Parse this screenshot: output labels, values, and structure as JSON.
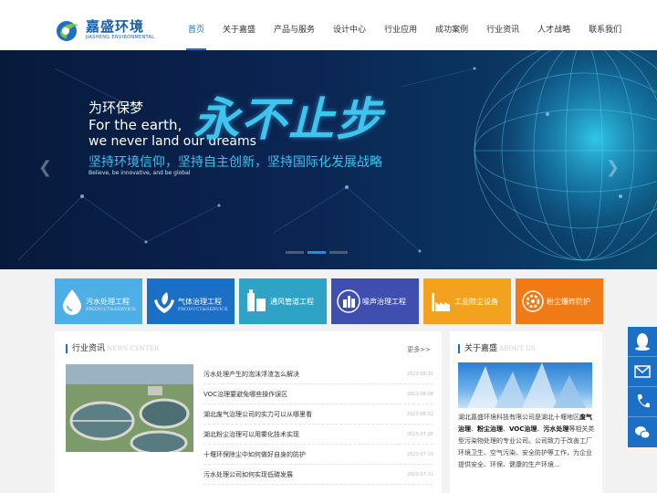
{
  "brand": {
    "name_cn": "嘉盛环境",
    "name_en": "JIASHENG ENVIRONMENTAL",
    "colors": {
      "primary": "#1b6fc4",
      "accent": "#33c6f0"
    }
  },
  "nav": {
    "items": [
      "首页",
      "关于嘉盛",
      "产品与服务",
      "设计中心",
      "行业应用",
      "成功案例",
      "行业资讯",
      "人才战略",
      "联系我们"
    ],
    "active_index": 0
  },
  "banner": {
    "line1": "为环保梦",
    "line2": "For the earth,",
    "line3": "we never land our dreams",
    "big": "永不止步",
    "slogan": "坚持环境信仰，坚持自主创新，坚持国际化发展战略",
    "sub": "Believe, be innovative, and be global",
    "prev_icon": "chevron-left-icon",
    "next_icon": "chevron-right-icon",
    "slide_count": 3,
    "active_slide": 1
  },
  "services": [
    {
      "title": "污水处理工程",
      "sub": "PRODUCT&SERVICE",
      "color": "#4eaee6",
      "icon": "water-drop-icon"
    },
    {
      "title": "气体治理工程",
      "sub": "PRODUCT&SERVICE",
      "color": "#1b6fc4",
      "icon": "hands-leaf-icon"
    },
    {
      "title": "通风管道工程",
      "sub": "",
      "color": "#2fa3c6",
      "icon": "duct-icon"
    },
    {
      "title": "噪声治理工程",
      "sub": "",
      "color": "#3e4fb0",
      "icon": "city-icon"
    },
    {
      "title": "工业除尘设备",
      "sub": "",
      "color": "#f2a21e",
      "icon": "factory-icon"
    },
    {
      "title": "粉尘爆炸防护",
      "sub": "",
      "color": "#f07a16",
      "icon": "gear-icon"
    }
  ],
  "news": {
    "title": "行业资讯",
    "title_en": "NEWS CENTER",
    "more": "更多>>",
    "items": [
      {
        "title": "污水处理产生的泡沫浮渣怎么解决",
        "date": "2023-08-15"
      },
      {
        "title": "VOC治理要避免哪些操作误区",
        "date": "2023-08-08"
      },
      {
        "title": "湖北废气治理公司的实力可以从哪里看",
        "date": "2023-08-02"
      },
      {
        "title": "湖北粉尘治理可以用雾化技术实现",
        "date": "2023-07-26"
      },
      {
        "title": "十堰环保除尘中如何做好自身的防护",
        "date": "2023-07-19"
      },
      {
        "title": "污水处理公司如何实现低碳发展",
        "date": "2023-07-11"
      }
    ]
  },
  "about": {
    "title": "关于嘉盛",
    "title_en": "ABOUT US",
    "intro_a": "湖北嘉盛环境科技有限公司是湖北十堰地区",
    "intro_b1": "废气治理",
    "sep1": "、",
    "intro_b2": "粉尘治理",
    "sep2": "、",
    "intro_b3": "VOC治理",
    "sep3": "、",
    "intro_b4": "污水处理",
    "intro_c": "等相关类型污染物处理的专业公司。公司致力于改善工厂环境卫生、空气污染、安全防护等工作，为企业提供安全、环保、健康的生产环境..."
  },
  "sidebar": {
    "icons": [
      "qq-icon",
      "mail-icon",
      "phone-icon",
      "wechat-icon"
    ]
  }
}
